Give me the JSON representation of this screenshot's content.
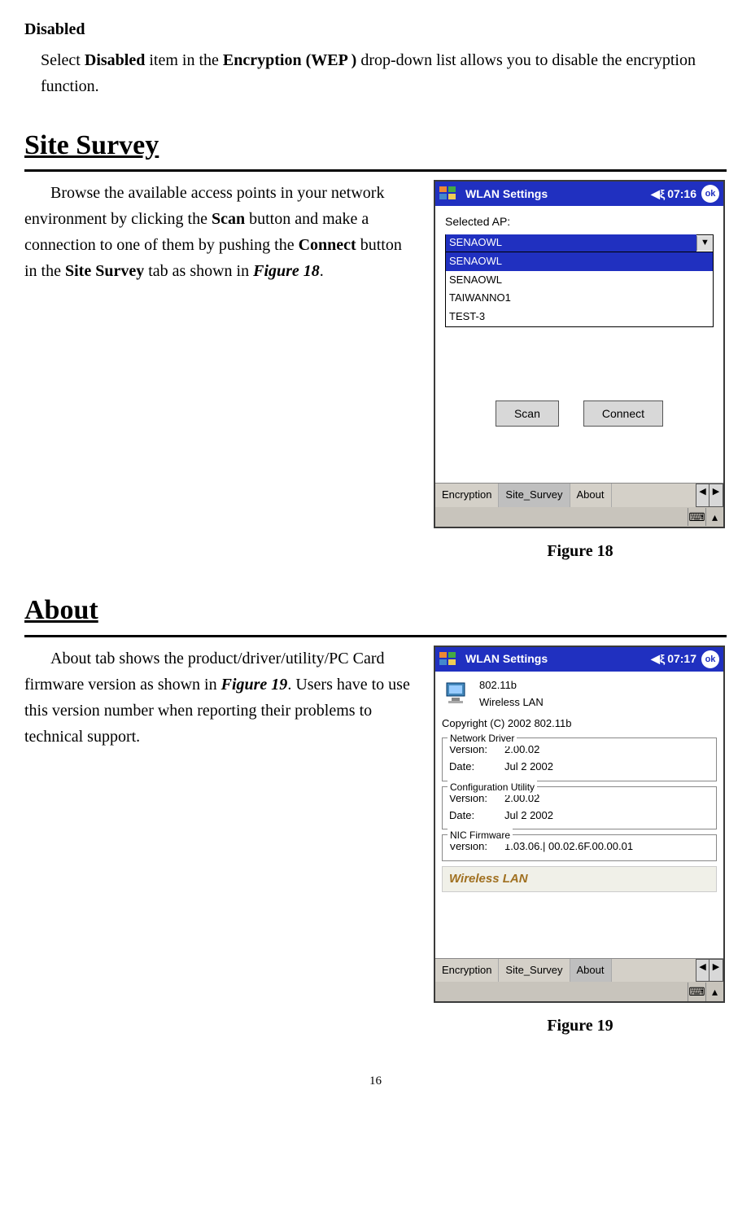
{
  "disabled": {
    "title": "Disabled",
    "text_1": "Select ",
    "bold_1": "Disabled",
    "text_2": " item in the ",
    "bold_2": "Encryption (WEP )",
    "text_3": " drop-down list allows you to disable the encryption function."
  },
  "site_heading": "Site Survey",
  "site_text": {
    "t1": "Browse the available access points in your network environment by clicking the ",
    "b1": "Scan",
    "t2": " button and make a connection to one of them by pushing the ",
    "b2": "Connect",
    "t3": " button in the ",
    "b3": "Site Survey",
    "t4": " tab as shown in ",
    "i1": "Figure 18",
    "t5": "."
  },
  "fig18": {
    "caption": "Figure 18",
    "title": "WLAN Settings",
    "time": "07:16",
    "ok": "ok",
    "selected_label": "Selected AP:",
    "combo_value": "SENAOWL",
    "options": [
      "SENAOWL",
      "SENAOWL",
      "TAIWANNO1",
      "TEST-3"
    ],
    "scan": "Scan",
    "connect": "Connect",
    "tabs": [
      "Encryption",
      "Site_Survey",
      "About"
    ]
  },
  "about_heading": "About",
  "about_text": {
    "t1": "About tab shows the product/driver/utility/PC Card firmware version as shown in ",
    "i1": "Figure 19",
    "t2": ". Users have to use this version number when reporting their problems to technical support."
  },
  "fig19": {
    "caption": "Figure 19",
    "title": "WLAN Settings",
    "time": "07:17",
    "ok": "ok",
    "prod1": "802.11b",
    "prod2": "Wireless LAN",
    "copyright": "Copyright (C) 2002  802.11b",
    "driver_title": "Network Driver",
    "config_title": "Configuration Utility",
    "nic_title": "NIC Firmware",
    "version_label": "Version:",
    "date_label": "Date:",
    "driver_ver": "2.00.02",
    "driver_date": "Jul  2 2002",
    "config_ver": "2.00.02",
    "config_date": "Jul  2 2002",
    "nic_ver": "1.03.06.| 00.02.6F.00.00.01",
    "brand": "Wireless LAN",
    "tabs": [
      "Encryption",
      "Site_Survey",
      "About"
    ]
  },
  "page_number": "16"
}
